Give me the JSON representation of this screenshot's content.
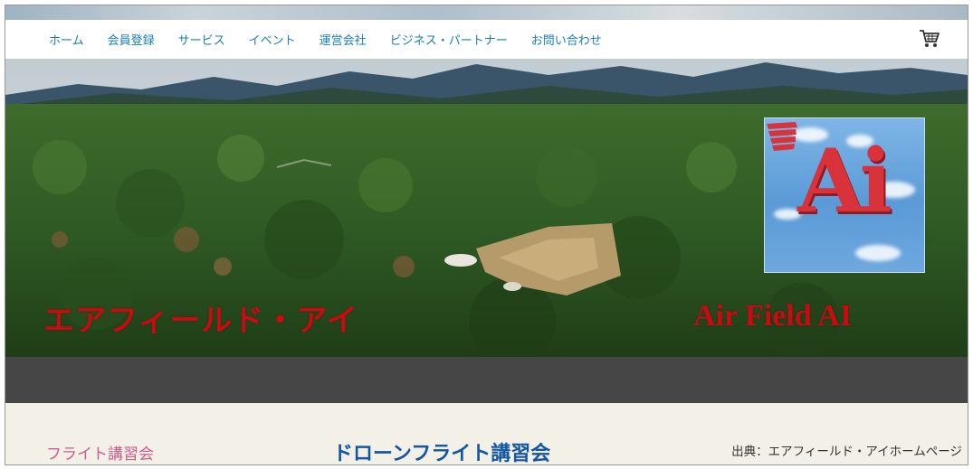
{
  "nav": {
    "items": [
      {
        "label": "ホーム"
      },
      {
        "label": "会員登録"
      },
      {
        "label": "サービス"
      },
      {
        "label": "イベント"
      },
      {
        "label": "運営会社"
      },
      {
        "label": "ビジネス・パートナー"
      },
      {
        "label": "お問い合わせ"
      }
    ],
    "cart_icon": "shopping-cart-icon",
    "link_color": "#1a7fb2"
  },
  "hero": {
    "title_jp": "エアフィールド・アイ",
    "title_en": "Air Field AI",
    "logo_text": "Ai",
    "title_color": "#c80b10",
    "logo_color": "#d8323a"
  },
  "content": {
    "side_link": "フライト講習会",
    "heading": "ドローンフライト講習会"
  },
  "credit": "出典：エアフィールド・アイホームページ"
}
